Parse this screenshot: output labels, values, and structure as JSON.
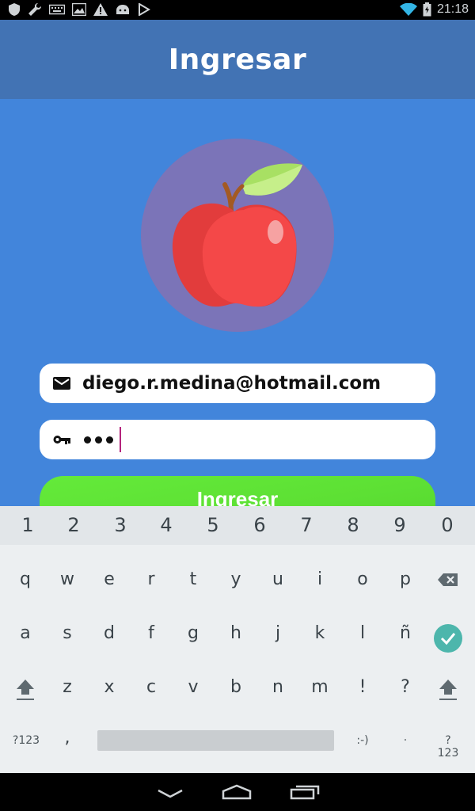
{
  "status_bar": {
    "time": "21:18",
    "left_icons": [
      "shield-icon",
      "wrench-icon",
      "keyboard-icon",
      "image-icon",
      "warning-icon",
      "android-icon",
      "play-store-icon"
    ],
    "right_icons": [
      "wifi-icon",
      "battery-icon"
    ]
  },
  "header": {
    "title": "Ingresar"
  },
  "logo": {
    "icon": "apple-icon",
    "circle_color": "#7b74b8"
  },
  "form": {
    "email": {
      "icon": "mail-icon",
      "value": "diego.r.medina@hotmail.com"
    },
    "password": {
      "icon": "key-icon",
      "masked_length": 3
    },
    "submit_label": "Ingresar"
  },
  "keyboard": {
    "number_row": [
      "1",
      "2",
      "3",
      "4",
      "5",
      "6",
      "7",
      "8",
      "9",
      "0"
    ],
    "row1": [
      "q",
      "w",
      "e",
      "r",
      "t",
      "y",
      "u",
      "i",
      "o",
      "p"
    ],
    "row2": [
      "a",
      "s",
      "d",
      "f",
      "g",
      "h",
      "j",
      "k",
      "l",
      "ñ"
    ],
    "row3": [
      "z",
      "x",
      "c",
      "v",
      "b",
      "n",
      "m",
      "!",
      "?"
    ],
    "bottom_left": "?123",
    "comma": ",",
    "smiley": ":-)",
    "period": "·",
    "bottom_right": "?123",
    "special_keys": [
      "backspace-icon",
      "done-check-icon",
      "shift-icon"
    ]
  },
  "nav_bar": {
    "buttons": [
      "back-icon",
      "home-icon",
      "recents-icon"
    ]
  },
  "colors": {
    "app_background": "#4285db",
    "header_background": "#4273b4",
    "button_green": "#5fe236",
    "accent_teal": "#4db6ac"
  }
}
